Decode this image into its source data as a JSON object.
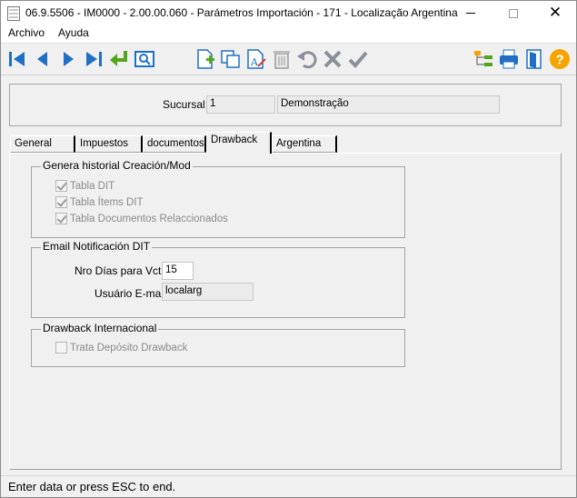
{
  "window": {
    "title": "06.9.5506 - IM0000 - 2.00.00.060 - Parámetros Importación - 171 - Localização Argentina",
    "minimize": "—",
    "maximize": "☐",
    "close": "✕"
  },
  "menu": {
    "archivo": "Archivo",
    "ayuda": "Ayuda"
  },
  "toolbar": {
    "icons": [
      "first-record-icon",
      "previous-record-icon",
      "next-record-icon",
      "last-record-icon",
      "go-to-icon",
      "search-icon",
      "add-record-icon",
      "copy-record-icon",
      "edit-record-icon",
      "delete-record-icon",
      "undo-icon",
      "cancel-icon",
      "save-icon",
      "tree-icon",
      "print-icon",
      "exit-icon",
      "help-icon"
    ],
    "colors": {
      "blue": "#1f6fc7",
      "green": "#55a51c",
      "yellow": "#f5a400",
      "gray": "#9a9a9a"
    }
  },
  "header": {
    "sucursal_label": "Sucursal:",
    "sucursal_code": "1",
    "sucursal_name": "Demonstração"
  },
  "tabs": [
    {
      "label": "General",
      "active": false
    },
    {
      "label": "Impuestos",
      "active": false
    },
    {
      "label": "documentos",
      "active": false
    },
    {
      "label": "Drawback",
      "active": true
    },
    {
      "label": "Argentina",
      "active": false
    }
  ],
  "drawback": {
    "historial": {
      "title": "Genera historial Creación/Mod",
      "items": [
        {
          "label": "Tabla DIT",
          "checked": true
        },
        {
          "label": "Tabla Ítems DIT",
          "checked": true
        },
        {
          "label": "Tabla Documentos Relaccionados",
          "checked": true
        }
      ]
    },
    "email": {
      "title": "Email Notificación DIT",
      "dias_label": "Nro Días para Vcto:",
      "dias_value": "15",
      "usuario_label": "Usuário E-mail:",
      "usuario_value": "localarg"
    },
    "internacional": {
      "title": "Drawback Internacional",
      "deposito_label": "Trata Depósito Drawback",
      "deposito_checked": false
    }
  },
  "status": {
    "text": "Enter data or press ESC to end."
  }
}
